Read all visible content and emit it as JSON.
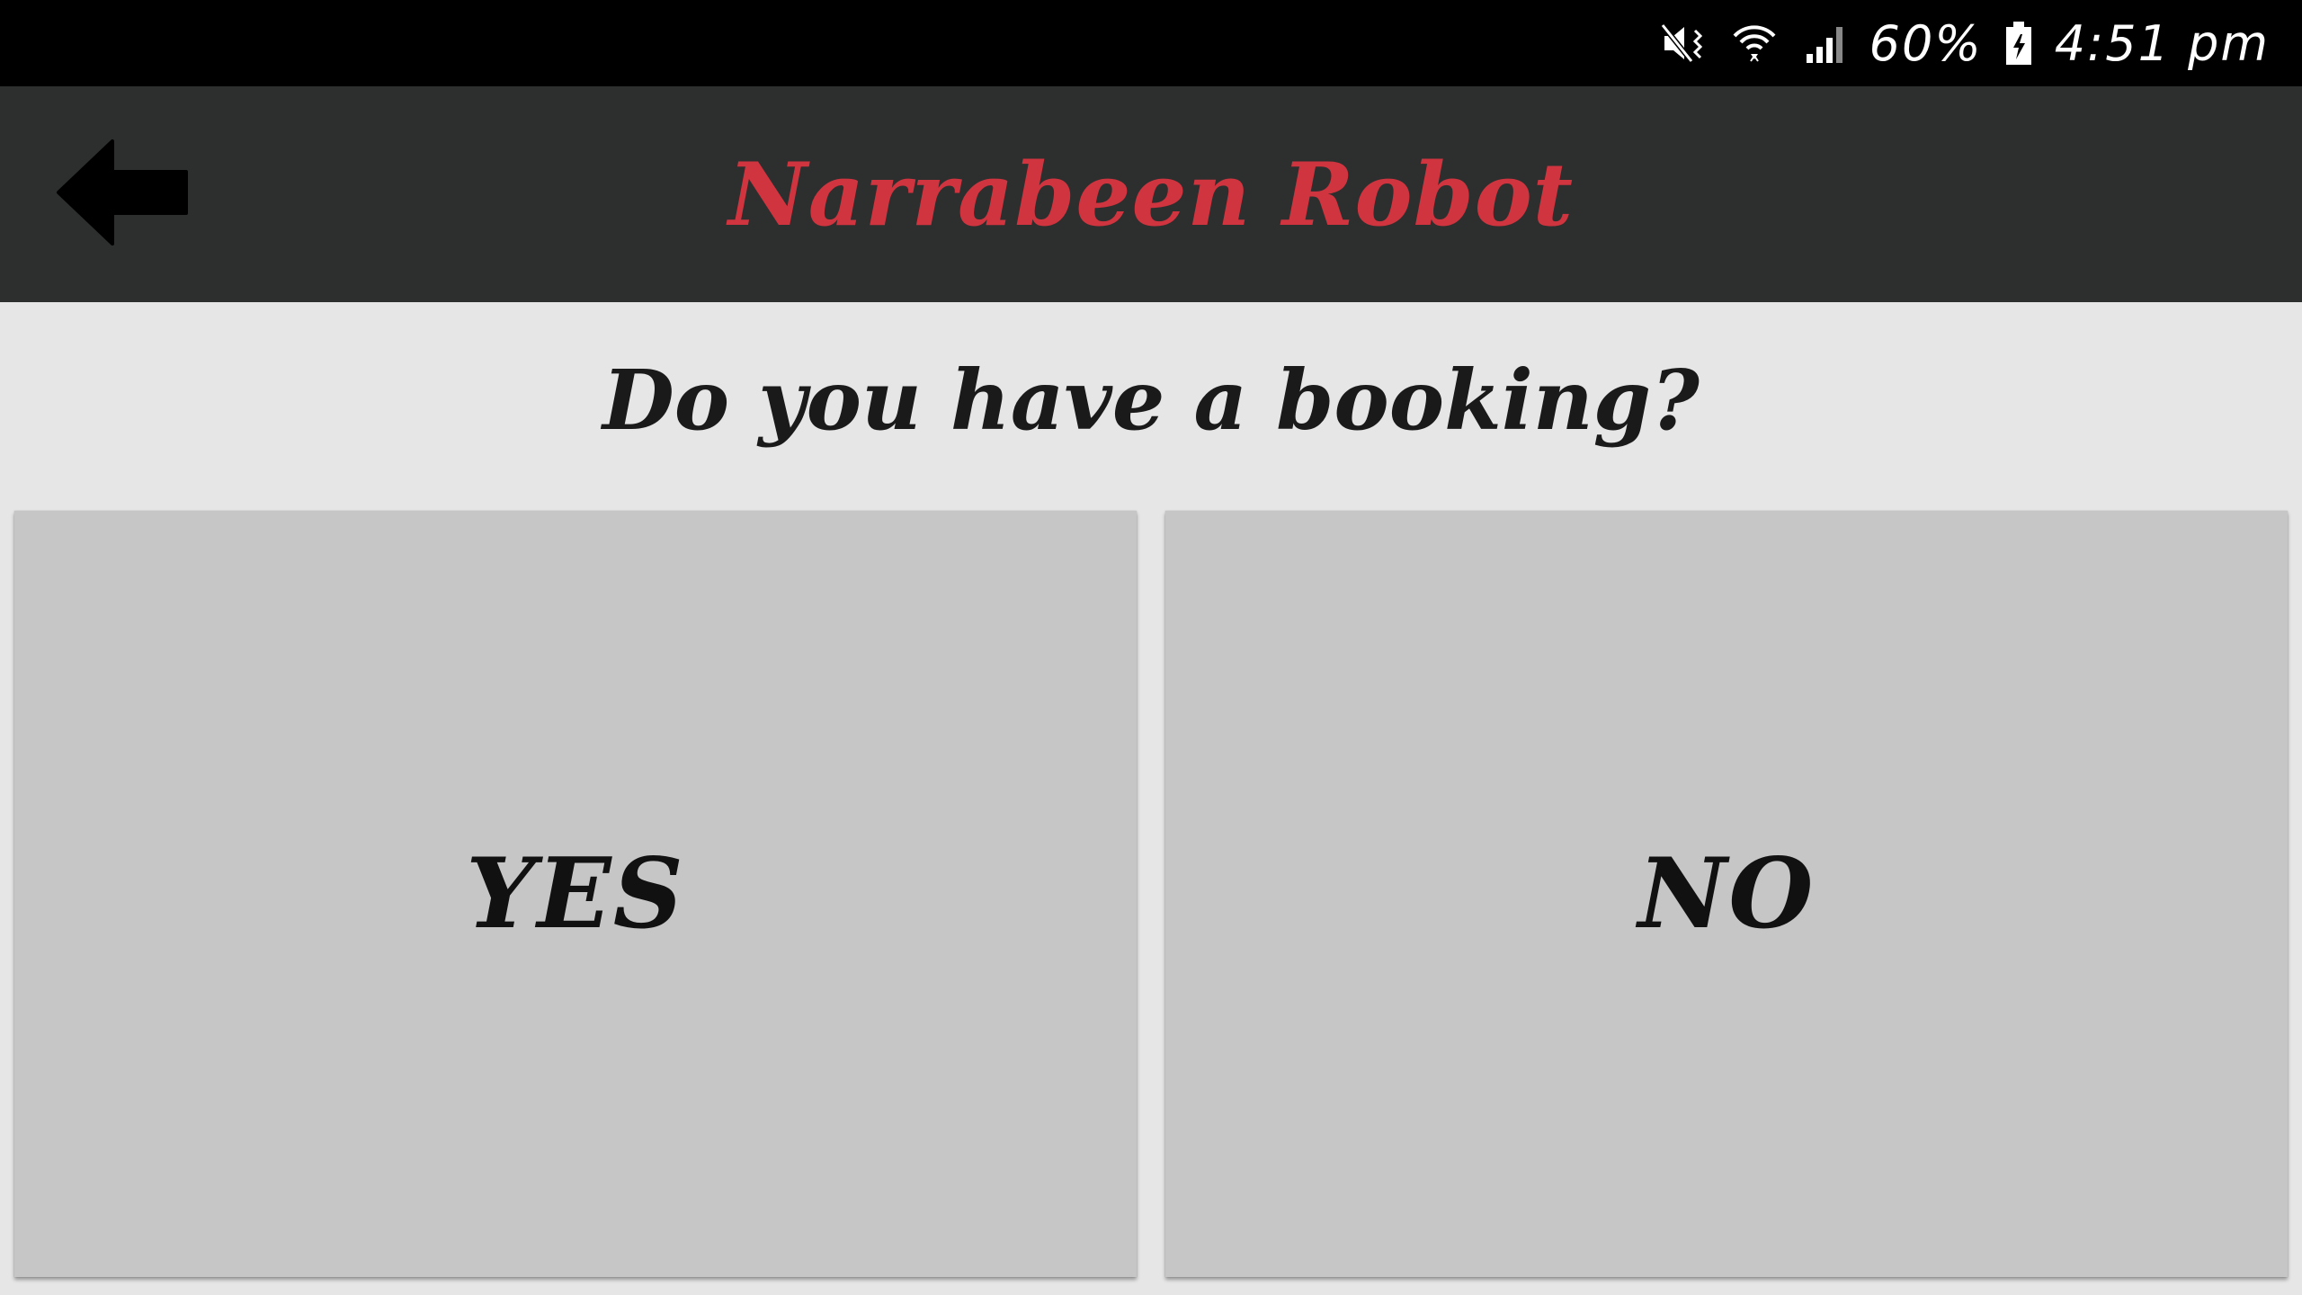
{
  "status_bar": {
    "battery_percent": "60%",
    "time": "4:51 pm",
    "icons": [
      "mute-vibrate-icon",
      "wifi-icon",
      "cell-signal-icon",
      "battery-charging-icon"
    ]
  },
  "app_bar": {
    "title": "Narrabeen Robot",
    "back_icon": "back-arrow-icon",
    "title_color": "#d0343f",
    "background": "#2d2e2e"
  },
  "main": {
    "question": "Do you have a booking?",
    "buttons": [
      {
        "label": "YES"
      },
      {
        "label": "NO"
      }
    ],
    "button_background": "#c6c6c6"
  }
}
